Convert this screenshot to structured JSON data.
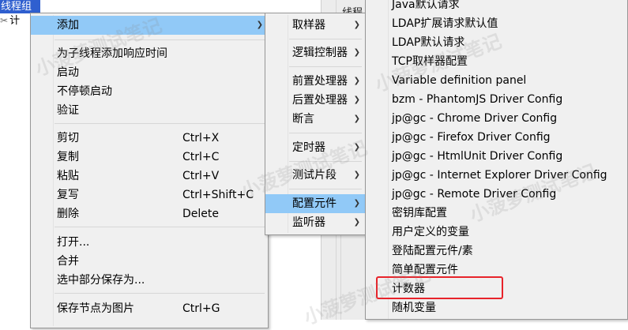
{
  "tree": {
    "selected_label": "线程组",
    "row2_label": "计",
    "row2_icon": "wrench-icon"
  },
  "background": {
    "label": "线程"
  },
  "menu1": {
    "items": [
      {
        "label": "添加",
        "shortcut": "",
        "submenu": true,
        "highlighted": true
      },
      {
        "label": "为子线程添加响应时间",
        "shortcut": ""
      },
      {
        "label": "启动",
        "shortcut": ""
      },
      {
        "label": "不停顿启动",
        "shortcut": ""
      },
      {
        "label": "验证",
        "shortcut": ""
      },
      {
        "label": "剪切",
        "shortcut": "Ctrl+X"
      },
      {
        "label": "复制",
        "shortcut": "Ctrl+C"
      },
      {
        "label": "粘贴",
        "shortcut": "Ctrl+V"
      },
      {
        "label": "复写",
        "shortcut": "Ctrl+Shift+C"
      },
      {
        "label": "删除",
        "shortcut": "Delete"
      },
      {
        "label": "打开...",
        "shortcut": ""
      },
      {
        "label": "合并",
        "shortcut": ""
      },
      {
        "label": "选中部分保存为...",
        "shortcut": ""
      },
      {
        "label": "保存节点为图片",
        "shortcut": "Ctrl+G"
      }
    ]
  },
  "menu2": {
    "items": [
      {
        "label": "取样器",
        "submenu": true
      },
      {
        "label": "逻辑控制器",
        "submenu": true
      },
      {
        "label": "前置处理器",
        "submenu": true
      },
      {
        "label": "后置处理器",
        "submenu": true
      },
      {
        "label": "断言",
        "submenu": true
      },
      {
        "label": "定时器",
        "submenu": true
      },
      {
        "label": "测试片段",
        "submenu": true
      },
      {
        "label": "配置元件",
        "submenu": true,
        "highlighted": true
      },
      {
        "label": "监听器",
        "submenu": true
      }
    ]
  },
  "menu3": {
    "items": [
      {
        "label": "Java默认请求"
      },
      {
        "label": "LDAP扩展请求默认值"
      },
      {
        "label": "LDAP默认请求"
      },
      {
        "label": "TCP取样器配置"
      },
      {
        "label": "Variable definition panel"
      },
      {
        "label": "bzm - PhantomJS Driver Config"
      },
      {
        "label": "jp@gc - Chrome Driver Config"
      },
      {
        "label": "jp@gc - Firefox Driver Config"
      },
      {
        "label": "jp@gc - HtmlUnit Driver Config"
      },
      {
        "label": "jp@gc - Internet Explorer Driver Config"
      },
      {
        "label": "jp@gc - Remote Driver Config"
      },
      {
        "label": "密钥库配置"
      },
      {
        "label": "用户定义的变量"
      },
      {
        "label": "登陆配置元件/素"
      },
      {
        "label": "简单配置元件"
      },
      {
        "label": "计数器",
        "annotated": true
      },
      {
        "label": "随机变量"
      }
    ]
  },
  "arrow_glyph": "❯",
  "watermark_text": "小菠萝测试笔记",
  "colors": {
    "highlight": "#91c9f7",
    "annotation_box": "#e8232a",
    "tree_selection": "#2f5fcf"
  }
}
